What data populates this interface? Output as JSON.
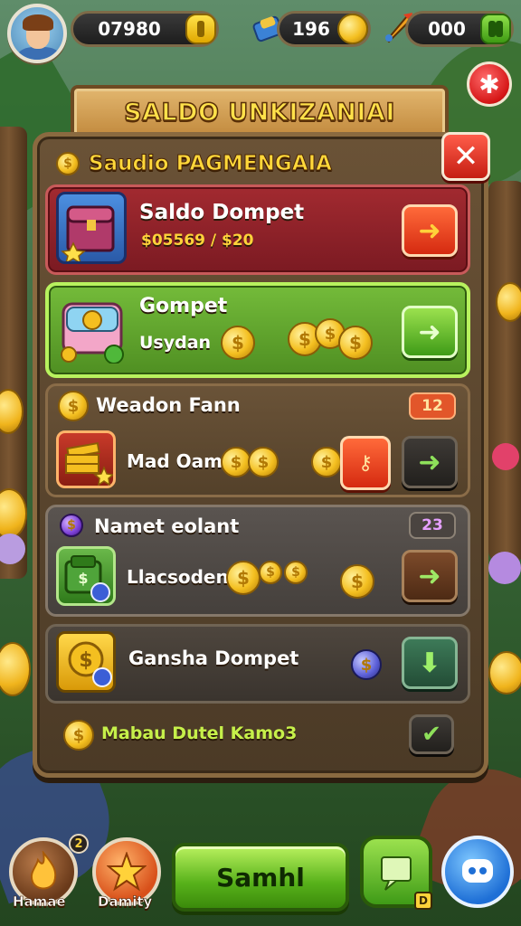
{
  "hud": {
    "coins_value": "07980",
    "gems_value": "196",
    "tickets_value": "000"
  },
  "banner": {
    "title": "SALDO UNKIZANIAI"
  },
  "panel": {
    "header_title": "Saudio PAGMENGAIA"
  },
  "rows": [
    {
      "title": "Saldo Dompet",
      "subtitle": "$05569 / $20",
      "style": "red",
      "action": "arrow-right"
    },
    {
      "title": "Gompet",
      "subtitle": "Usydan",
      "style": "green",
      "action": "arrow-right"
    },
    {
      "title": "Weadon Fann",
      "badge": "12",
      "item_label": "Mad Oam",
      "style": "brown",
      "action": "arrow-right"
    },
    {
      "title": "Namet eolant",
      "badge": "23",
      "item_label": "Llacsoden",
      "style": "gray",
      "action": "arrow-right"
    },
    {
      "title": "Gansha Dompet",
      "style": "dark",
      "action": "arrow-down"
    },
    {
      "title": "Mabau Dutel Kamo3",
      "style": "footer",
      "action": "check"
    }
  ],
  "bottom": {
    "left_label": "Hamae",
    "left2_label": "Damity",
    "play_label": "Samhl"
  },
  "colors": {
    "accent_gold": "#ffd83a",
    "panel_wood": "#6a5236",
    "red_row": "#8d1f26",
    "green_row": "#6fb43a"
  },
  "icons": [
    "avatar",
    "coin-icon",
    "gem-icon",
    "rocket-icon",
    "settings-icon",
    "close-icon",
    "treasure-chest-icon",
    "wallet-icon",
    "coin-stack-icon",
    "money-bag-icon",
    "dollar-card-icon",
    "flame-icon",
    "star-badge-icon",
    "map-icon",
    "discord-icon"
  ]
}
